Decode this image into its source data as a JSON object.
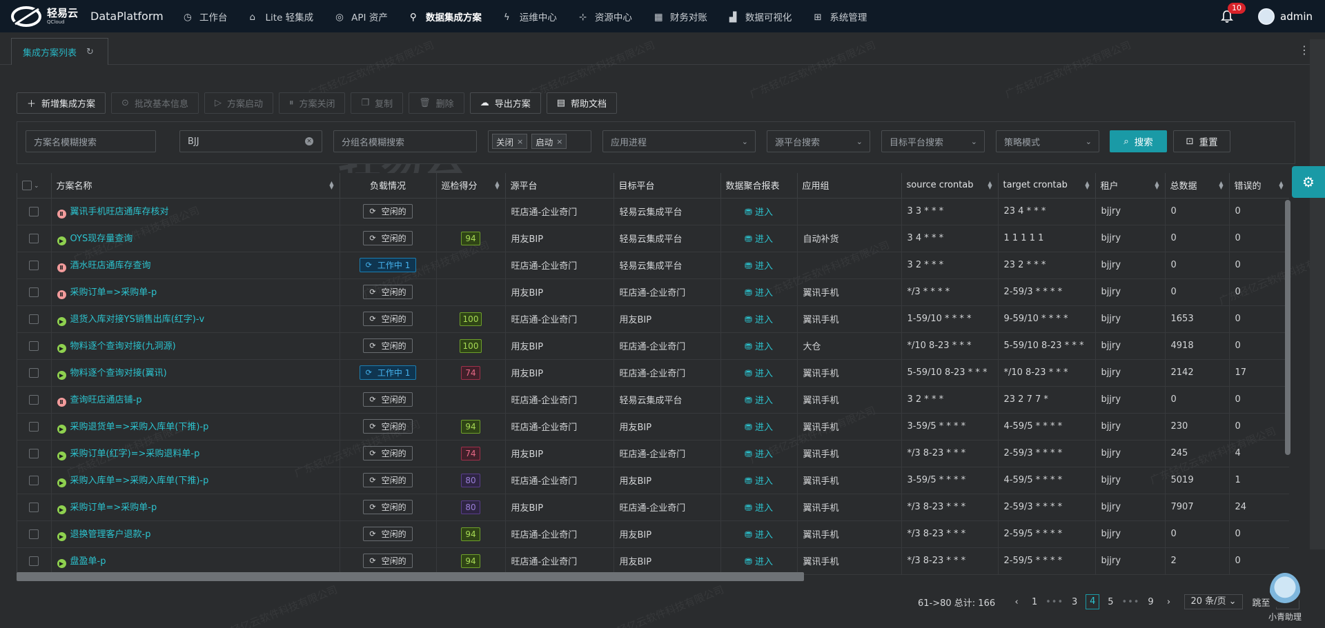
{
  "header": {
    "logo_text": "轻易云",
    "logo_sub": "QCloud",
    "brand": "DataPlatform",
    "nav": [
      {
        "label": "工作台",
        "icon": "clock-icon"
      },
      {
        "label": "Lite 轻集成",
        "icon": "rocket-icon"
      },
      {
        "label": "API 资产",
        "icon": "compass-icon"
      },
      {
        "label": "数据集成方案",
        "icon": "network-icon"
      },
      {
        "label": "运维中心",
        "icon": "bolt-icon"
      },
      {
        "label": "资源中心",
        "icon": "hierarchy-icon"
      },
      {
        "label": "财务对账",
        "icon": "calculator-icon"
      },
      {
        "label": "数据可视化",
        "icon": "chart-icon"
      },
      {
        "label": "系统管理",
        "icon": "grid-icon"
      }
    ],
    "notifications": "10",
    "user": "admin"
  },
  "tab": {
    "label": "集成方案列表"
  },
  "toolbar": {
    "add": "新增集成方案",
    "batch_edit": "批改基本信息",
    "start": "方案启动",
    "stop": "方案关闭",
    "copy": "复制",
    "delete": "删除",
    "export": "导出方案",
    "help": "帮助文档"
  },
  "filters": {
    "name_placeholder": "方案名模糊搜索",
    "keyword_value": "BJJ",
    "group_placeholder": "分组名模糊搜索",
    "status_chips": [
      "关闭",
      "启动"
    ],
    "app_process_placeholder": "应用进程",
    "source_platform_placeholder": "源平台搜索",
    "target_platform_placeholder": "目标平台搜索",
    "strategy_placeholder": "策略模式",
    "search_label": "搜索",
    "reset_label": "重置"
  },
  "table": {
    "columns": [
      "方案名称",
      "负载情况",
      "巡检得分",
      "源平台",
      "目标平台",
      "数据聚合报表",
      "应用组",
      "source crontab",
      "target crontab",
      "租户",
      "总数据",
      "错误的"
    ],
    "enter_label": "进入",
    "rows": [
      {
        "status": "paused",
        "name": "翼讯手机旺店通库存核对",
        "load": "空闲的",
        "load_type": "idle",
        "score": "",
        "score_color": "",
        "source": "旺店通-企业奇门",
        "target": "轻易云集成平台",
        "group": "",
        "src_cron": "3 3 * * *",
        "tgt_cron": "23 4 * * *",
        "tenant": "bjjry",
        "total": "0",
        "errors": "0"
      },
      {
        "status": "running",
        "name": "OYS现存量查询",
        "load": "空闲的",
        "load_type": "idle",
        "score": "94",
        "score_color": "green",
        "source": "用友BIP",
        "target": "轻易云集成平台",
        "group": "自动补货",
        "src_cron": "3 4 * * *",
        "tgt_cron": "1 1 1 1 1",
        "tenant": "bjjry",
        "total": "0",
        "errors": "0"
      },
      {
        "status": "paused",
        "name": "酒水旺店通库存查询",
        "load": "工作中 1",
        "load_type": "work",
        "score": "",
        "score_color": "",
        "source": "旺店通-企业奇门",
        "target": "轻易云集成平台",
        "group": "",
        "src_cron": "3 2 * * *",
        "tgt_cron": "23 2 * * *",
        "tenant": "bjjry",
        "total": "0",
        "errors": "0"
      },
      {
        "status": "paused",
        "name": "采购订单=>采购单-p",
        "load": "空闲的",
        "load_type": "idle",
        "score": "",
        "score_color": "",
        "source": "用友BIP",
        "target": "旺店通-企业奇门",
        "group": "翼讯手机",
        "src_cron": "*/3 * * * *",
        "tgt_cron": "2-59/3 * * * *",
        "tenant": "bjjry",
        "total": "0",
        "errors": "0"
      },
      {
        "status": "running",
        "name": "退货入库对接YS销售出库(红字)-v",
        "load": "空闲的",
        "load_type": "idle",
        "score": "100",
        "score_color": "green",
        "source": "旺店通-企业奇门",
        "target": "用友BIP",
        "group": "翼讯手机",
        "src_cron": "1-59/10 * * * *",
        "tgt_cron": "9-59/10 * * * *",
        "tenant": "bjjry",
        "total": "1653",
        "errors": "0"
      },
      {
        "status": "running",
        "name": "物料逐个查询对接(九洞源)",
        "load": "空闲的",
        "load_type": "idle",
        "score": "100",
        "score_color": "green",
        "source": "用友BIP",
        "target": "旺店通-企业奇门",
        "group": "大仓",
        "src_cron": "*/10 8-23 * * *",
        "tgt_cron": "5-59/10 8-23 * * *",
        "tenant": "bjjry",
        "total": "4918",
        "errors": "0"
      },
      {
        "status": "running",
        "name": "物料逐个查询对接(翼讯)",
        "load": "工作中 1",
        "load_type": "work",
        "score": "74",
        "score_color": "red",
        "source": "用友BIP",
        "target": "旺店通-企业奇门",
        "group": "翼讯手机",
        "src_cron": "5-59/10 8-23 * * *",
        "tgt_cron": "*/10 8-23 * * *",
        "tenant": "bjjry",
        "total": "2142",
        "errors": "17"
      },
      {
        "status": "paused",
        "name": "查询旺店通店铺-p",
        "load": "空闲的",
        "load_type": "idle",
        "score": "",
        "score_color": "",
        "source": "旺店通-企业奇门",
        "target": "轻易云集成平台",
        "group": "翼讯手机",
        "src_cron": "3 2 * * *",
        "tgt_cron": "23 2 7 7 *",
        "tenant": "bjjry",
        "total": "0",
        "errors": "0"
      },
      {
        "status": "running",
        "name": "采购退货单=>采购入库单(下推)-p",
        "load": "空闲的",
        "load_type": "idle",
        "score": "94",
        "score_color": "green",
        "source": "旺店通-企业奇门",
        "target": "用友BIP",
        "group": "翼讯手机",
        "src_cron": "3-59/5 * * * *",
        "tgt_cron": "4-59/5 * * * *",
        "tenant": "bjjry",
        "total": "230",
        "errors": "0"
      },
      {
        "status": "running",
        "name": "采购订单(红字)=>采购退料单-p",
        "load": "空闲的",
        "load_type": "idle",
        "score": "74",
        "score_color": "red",
        "source": "用友BIP",
        "target": "旺店通-企业奇门",
        "group": "翼讯手机",
        "src_cron": "*/3 8-23 * * *",
        "tgt_cron": "2-59/3 * * * *",
        "tenant": "bjjry",
        "total": "245",
        "errors": "4"
      },
      {
        "status": "running",
        "name": "采购入库单=>采购入库单(下推)-p",
        "load": "空闲的",
        "load_type": "idle",
        "score": "80",
        "score_color": "purple",
        "source": "旺店通-企业奇门",
        "target": "用友BIP",
        "group": "翼讯手机",
        "src_cron": "3-59/5 * * * *",
        "tgt_cron": "4-59/5 * * * *",
        "tenant": "bjjry",
        "total": "5019",
        "errors": "1"
      },
      {
        "status": "running",
        "name": "采购订单=>采购单-p",
        "load": "空闲的",
        "load_type": "idle",
        "score": "80",
        "score_color": "purple",
        "source": "用友BIP",
        "target": "旺店通-企业奇门",
        "group": "翼讯手机",
        "src_cron": "*/3 8-23 * * *",
        "tgt_cron": "2-59/3 * * * *",
        "tenant": "bjjry",
        "total": "7907",
        "errors": "24"
      },
      {
        "status": "running",
        "name": "退换管理客户退款-p",
        "load": "空闲的",
        "load_type": "idle",
        "score": "94",
        "score_color": "green",
        "source": "旺店通-企业奇门",
        "target": "用友BIP",
        "group": "翼讯手机",
        "src_cron": "*/3 8-23 * * *",
        "tgt_cron": "2-59/5 * * * *",
        "tenant": "bjjry",
        "total": "0",
        "errors": "0"
      },
      {
        "status": "running",
        "name": "盘盈单-p",
        "load": "空闲的",
        "load_type": "idle",
        "score": "94",
        "score_color": "green",
        "source": "旺店通-企业奇门",
        "target": "用友BIP",
        "group": "翼讯手机",
        "src_cron": "*/3 8-23 * * *",
        "tgt_cron": "2-59/5 * * * *",
        "tenant": "bjjry",
        "total": "2",
        "errors": "0"
      }
    ]
  },
  "pagination": {
    "range_total": "61->80 总计: 166",
    "pages": [
      "1",
      "•••",
      "3",
      "4",
      "5",
      "•••",
      "9"
    ],
    "current": "4",
    "page_size": "20 条/页",
    "jump_label": "跳至"
  },
  "assistant": {
    "label": "小青助理"
  },
  "watermark": {
    "text": "广东轻亿云软件科技有限公司",
    "logo": "轻易云"
  },
  "colors": {
    "accent": "#1a9aa6",
    "link": "#2cc3cf",
    "topbar": "#0f1a26",
    "background": "#2a2c2e"
  }
}
